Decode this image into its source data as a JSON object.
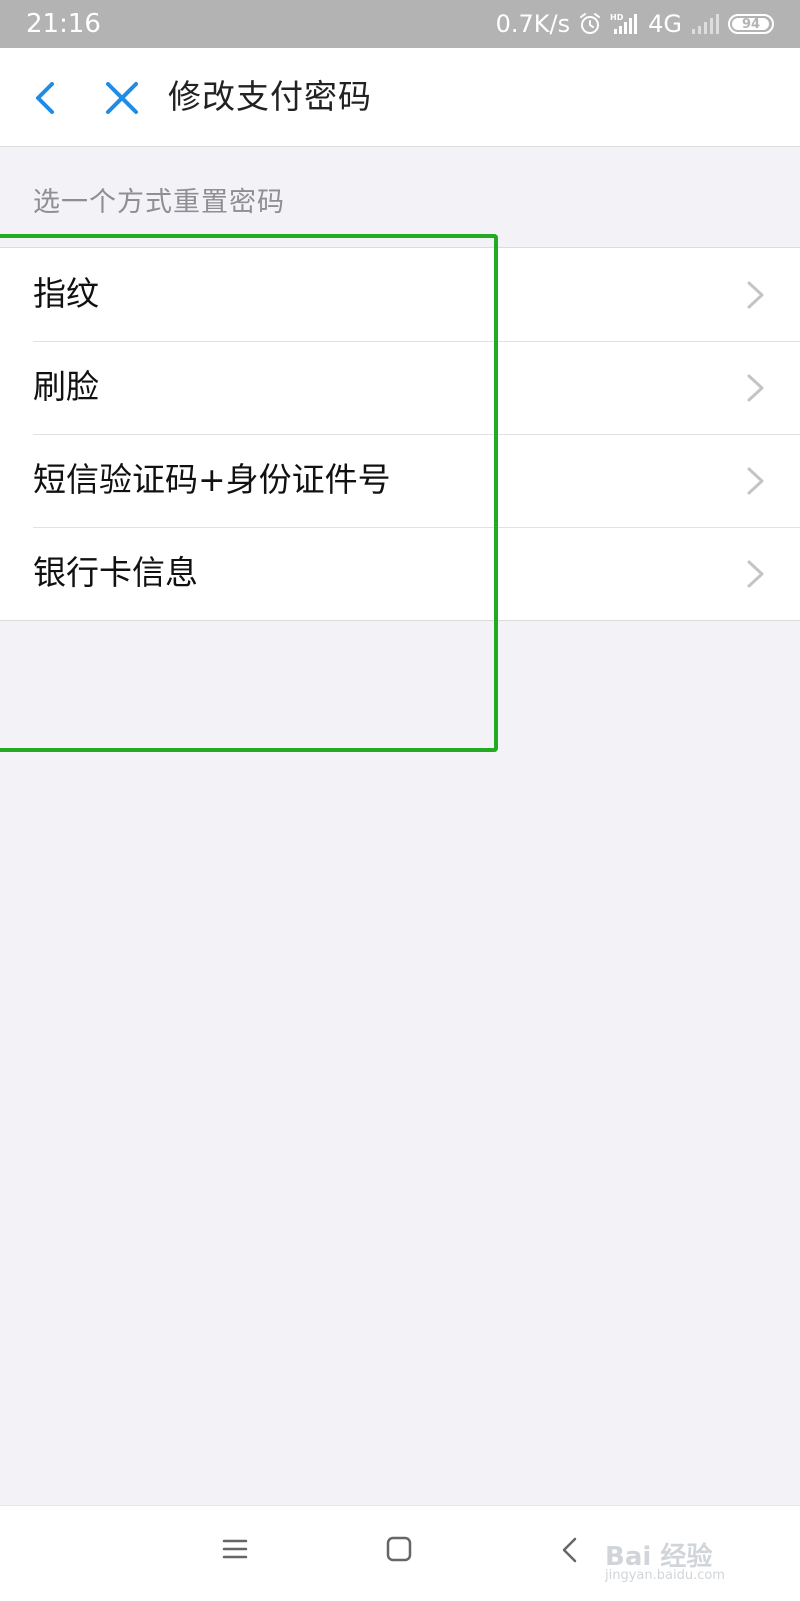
{
  "status_bar": {
    "time": "21:16",
    "network_speed": "0.7K/s",
    "network_type": "4G",
    "battery": "94",
    "icons": [
      "alarm-icon",
      "hd-signal-icon",
      "signal-icon",
      "battery-icon"
    ]
  },
  "nav": {
    "title": "修改支付密码",
    "back_icon": "chevron-left-icon",
    "close_icon": "close-icon"
  },
  "section": {
    "title": "选一个方式重置密码"
  },
  "options": [
    {
      "label": "指纹"
    },
    {
      "label": "刷脸"
    },
    {
      "label": "短信验证码+身份证件号"
    },
    {
      "label": "银行卡信息"
    }
  ],
  "bottom_nav": {
    "icons": [
      "menu-icon",
      "home-icon",
      "back-icon"
    ]
  },
  "watermark": {
    "title": "Bai 经验",
    "url": "jingyan.baidu.com"
  },
  "colors": {
    "accent": "#1f8ce6",
    "highlight": "#22aa22",
    "background": "#f2f2f7"
  }
}
